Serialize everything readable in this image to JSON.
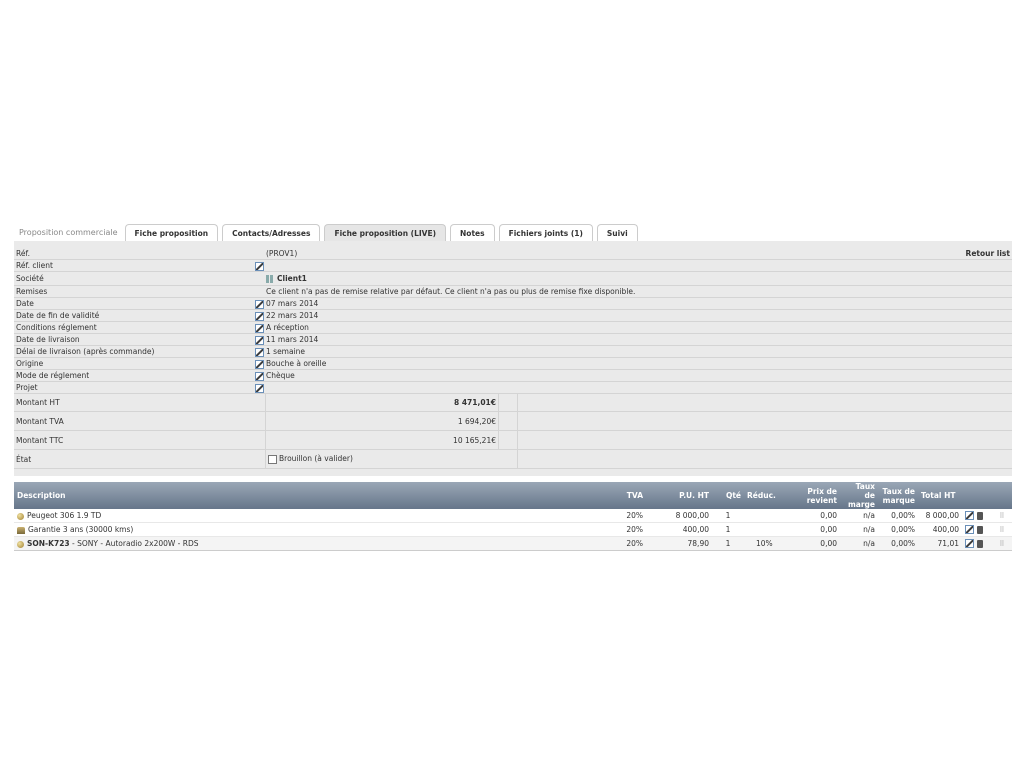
{
  "tabs": {
    "title": "Proposition commerciale",
    "items": [
      {
        "label": "Fiche proposition",
        "active": false
      },
      {
        "label": "Contacts/Adresses",
        "active": false
      },
      {
        "label": "Fiche proposition (LIVE)",
        "active": true
      },
      {
        "label": "Notes",
        "active": false
      },
      {
        "label": "Fichiers joints (1)",
        "active": false
      },
      {
        "label": "Suivi",
        "active": false
      }
    ]
  },
  "info": {
    "ref_label": "Réf.",
    "ref_value": "(PROV1)",
    "back_link": "Retour list",
    "rows": [
      {
        "label": "Réf. client",
        "value": "",
        "editable": true
      },
      {
        "label": "Société",
        "value": "Client1",
        "editable": false
      },
      {
        "label": "Remises",
        "value": "Ce client n'a pas de remise relative par défaut. Ce client n'a pas ou plus de remise fixe disponible.",
        "editable": false
      },
      {
        "label": "Date",
        "value": "07 mars 2014",
        "editable": true
      },
      {
        "label": "Date de fin de validité",
        "value": "22 mars 2014",
        "editable": true
      },
      {
        "label": "Conditions réglement",
        "value": "A réception",
        "editable": true
      },
      {
        "label": "Date de livraison",
        "value": "11 mars 2014",
        "editable": true
      },
      {
        "label": "Délai de livraison (après commande)",
        "value": "1 semaine",
        "editable": true
      },
      {
        "label": "Origine",
        "value": "Bouche à oreille",
        "editable": true
      },
      {
        "label": "Mode de réglement",
        "value": "Chèque",
        "editable": true
      },
      {
        "label": "Projet",
        "value": "",
        "editable": true
      }
    ]
  },
  "totals": {
    "ht_label": "Montant HT",
    "ht": "8 471,01€",
    "tva_label": "Montant TVA",
    "tva": "1 694,20€",
    "ttc_label": "Montant TTC",
    "ttc": "10 165,21€",
    "etat_label": "État",
    "etat": "Brouillon (à valider)"
  },
  "lines": {
    "headers": {
      "desc": "Description",
      "tva": "TVA",
      "pu": "P.U. HT",
      "qty": "Qté",
      "reduc": "Réduc.",
      "cost": "Prix de revient",
      "marge": "Taux de marge",
      "marque": "Taux de marque",
      "total": "Total HT"
    },
    "rows": [
      {
        "type": "product",
        "ref": "",
        "desc": "Peugeot 306 1.9 TD",
        "tva": "20%",
        "pu": "8 000,00",
        "qty": "1",
        "reduc": "",
        "cost": "0,00",
        "marge": "n/a",
        "marque": "0,00%",
        "total": "8 000,00"
      },
      {
        "type": "service",
        "ref": "",
        "desc": "Garantie 3 ans (30000 kms)",
        "tva": "20%",
        "pu": "400,00",
        "qty": "1",
        "reduc": "",
        "cost": "0,00",
        "marge": "n/a",
        "marque": "0,00%",
        "total": "400,00"
      },
      {
        "type": "product",
        "ref": "SON-K723",
        "desc": " - SONY - Autoradio 2x200W - RDS",
        "tva": "20%",
        "pu": "78,90",
        "qty": "1",
        "reduc": "10%",
        "cost": "0,00",
        "marge": "n/a",
        "marque": "0,00%",
        "total": "71,01"
      }
    ]
  }
}
